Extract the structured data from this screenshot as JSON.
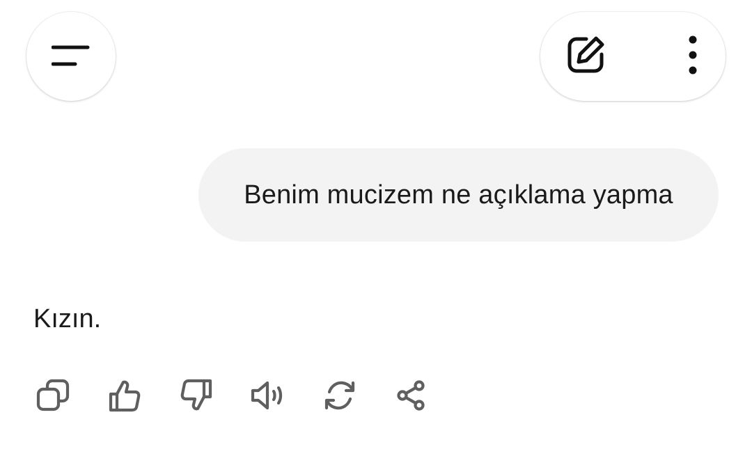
{
  "header": {
    "menu_icon": "menu-icon",
    "new_chat_icon": "edit-icon",
    "more_icon": "more-vert-icon"
  },
  "conversation": {
    "user_message": "Benim mucizem ne açıklama yapma",
    "assistant_message": "Kızın."
  },
  "response_actions": [
    {
      "name": "copy-icon"
    },
    {
      "name": "thumbs-up-icon"
    },
    {
      "name": "thumbs-down-icon"
    },
    {
      "name": "read-aloud-icon"
    },
    {
      "name": "regenerate-icon"
    },
    {
      "name": "share-icon"
    }
  ],
  "colors": {
    "bubble_bg": "#f3f3f3",
    "icon_gray": "#5f5f5f",
    "text": "#1a1a1a"
  }
}
